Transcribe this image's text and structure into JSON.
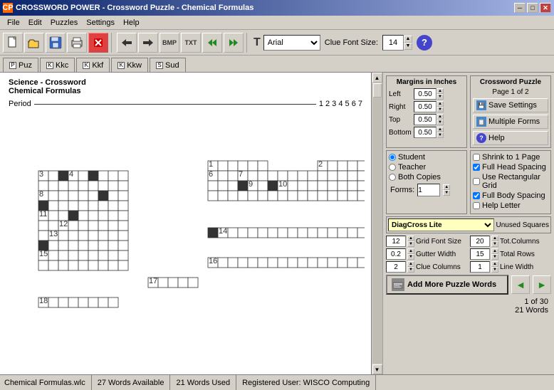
{
  "titleBar": {
    "icon": "CP",
    "title": "CROSSWORD POWER - Crossword Puzzle - Chemical Formulas",
    "minBtn": "─",
    "maxBtn": "□",
    "closeBtn": "✕"
  },
  "menuBar": {
    "items": [
      "File",
      "Edit",
      "Puzzles",
      "Settings",
      "Help"
    ]
  },
  "toolbar": {
    "fontName": "Arial",
    "fontNamePlaceholder": "Arial",
    "clueFontLabel": "Clue Font Size:",
    "clueFontSize": "14"
  },
  "tabs": [
    {
      "label": "Puz",
      "icon": "P"
    },
    {
      "label": "Kkc",
      "icon": "K"
    },
    {
      "label": "Kkf",
      "icon": "K"
    },
    {
      "label": "Kkw",
      "icon": "K"
    },
    {
      "label": "Sud",
      "icon": "S"
    }
  ],
  "puzzle": {
    "title1": "Science - Crossword",
    "title2": "Chemical Formulas",
    "periodLabel": "Period",
    "periodNumbers": "1 2 3 4 5 6 7"
  },
  "rightPanel": {
    "margins": {
      "title": "Margins in Inches",
      "left": {
        "label": "Left",
        "value": "0.50"
      },
      "right": {
        "label": "Right",
        "value": "0.50"
      },
      "top": {
        "label": "Top",
        "value": "0.50"
      },
      "bottom": {
        "label": "Bottom",
        "value": "0.50"
      }
    },
    "crosswordPuzzle": {
      "title": "Crossword Puzzle",
      "subtitle": "Page 1 of 2",
      "saveSettings": "Save Settings",
      "multipleForms": "Multiple Forms",
      "help": "Help"
    },
    "printOptions": {
      "student": "Student",
      "teacher": "Teacher",
      "bothCopies": "Both Copies"
    },
    "checkOptions": {
      "shrinkToPage": "Shrink to 1 Page",
      "fullHeadSpacing": "Full Head Spacing",
      "useRectangularGrid": "Use Rectangular Grid",
      "fullBodySpacing": "Full Body Spacing",
      "helpLetter": "Help Letter"
    },
    "formsLabel": "Forms:",
    "formsValue": "1",
    "fontSelect": "DiagCross Lite",
    "unusedSquares": "Unused Squares",
    "gridFontSize": {
      "label": "Grid Font Size",
      "value": "12",
      "rightLabel": "Tot.Columns",
      "rightValue": "20"
    },
    "gutterWidth": {
      "label": "Gutter Width",
      "value": "0.2",
      "rightLabel": "Total Rows",
      "rightValue": "15"
    },
    "clueColumns": {
      "label": "Clue Columns",
      "value": "2",
      "rightLabel": "Line Width",
      "rightValue": "1"
    },
    "addMorePuzzleWords": "Add More Puzzle Words",
    "pageStatus1": "1 of 30",
    "pageStatus2": "21 Words"
  },
  "statusBar": {
    "file": "Chemical Formulas.wlc",
    "wordsAvailable": "27 Words Available",
    "wordsUsed": "21 Words Used",
    "registeredUser": "Registered User: WISCO Computing"
  }
}
